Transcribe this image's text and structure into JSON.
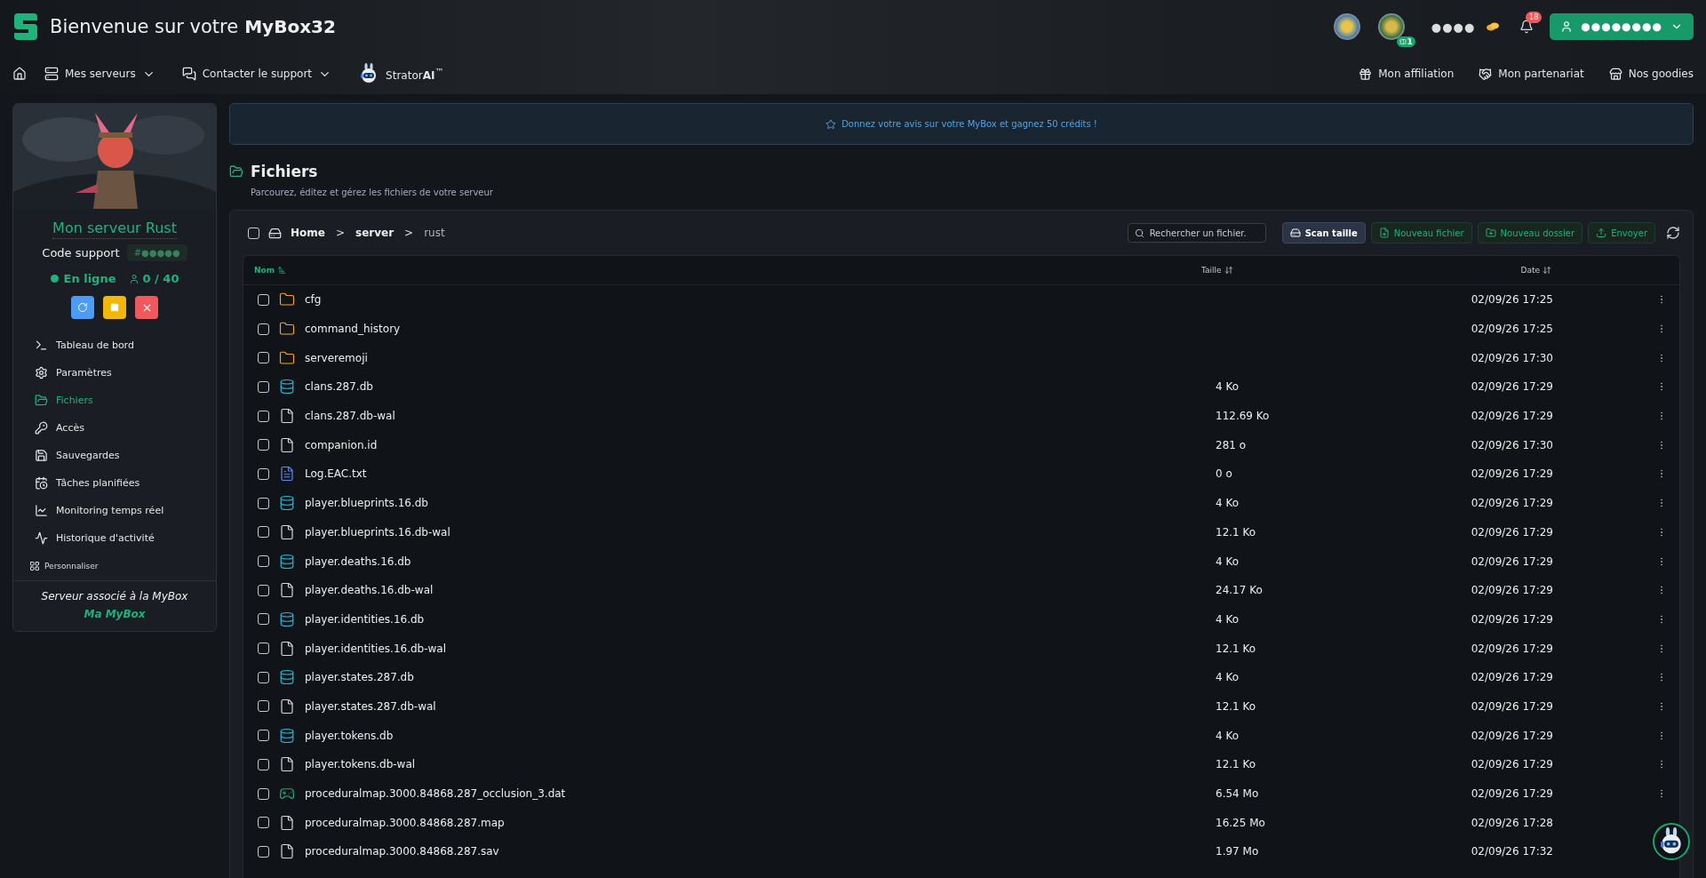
{
  "header": {
    "greeting": "Bienvenue sur votre",
    "box_name": "MyBox32",
    "coins": "●●●●",
    "ticket_badge": "1",
    "notifications": "18",
    "user": "●●●●●●●●"
  },
  "nav": {
    "left": [
      {
        "label": "Mes serveurs",
        "kind": "dropdown"
      },
      {
        "label": "Contacter le support",
        "kind": "dropdown"
      },
      {
        "label": "Strator**AI**$^{™}$",
        "kind": "brand"
      }
    ],
    "right": [
      {
        "label": "Mon affiliation",
        "kind": "gift"
      },
      {
        "label": "Mon partenariat",
        "kind": "handshake"
      },
      {
        "label": "Nos goodies",
        "kind": "store"
      }
    ]
  },
  "sidebar": {
    "server_name": "Mon serveur Rust",
    "code_label": "Code support",
    "code": "#●●●●●",
    "status": "En ligne",
    "online": true,
    "players": "0 / 40",
    "menu": [
      {
        "label": "Tableau de bord",
        "kind": "terminal",
        "selected": false
      },
      {
        "label": "Paramètres",
        "kind": "settings",
        "selected": false
      },
      {
        "label": "Fichiers",
        "kind": "folder",
        "selected": true
      },
      {
        "label": "Accès",
        "kind": "key",
        "selected": false
      },
      {
        "label": "Sauvegardes",
        "kind": "save",
        "selected": false
      },
      {
        "label": "Tâches planifiées",
        "kind": "calendar",
        "selected": false
      },
      {
        "label": "Monitoring temps réel",
        "kind": "chart",
        "selected": false
      },
      {
        "label": "Historique d'activité",
        "kind": "activity",
        "selected": false
      }
    ],
    "customize": "Personnaliser",
    "footer": "Serveur associé à la MyBox",
    "footer_link": "Ma MyBox"
  },
  "banner": "Donnez votre avis sur votre MyBox et gagnez 50 crédits !",
  "page": {
    "title": "Fichiers",
    "subtitle": "Parcourez, éditez et gérez les fichiers de votre serveur"
  },
  "toolbar": {
    "select_all": false,
    "breadcrumb": [
      "Home",
      "server",
      "rust"
    ],
    "separator": ">",
    "search_placeholder": "Rechercher un fichier.",
    "buttons": [
      {
        "label": "Scan taille",
        "kind": "neutral"
      },
      {
        "label": "Nouveau fichier",
        "kind": "file"
      },
      {
        "label": "Nouveau dossier",
        "kind": "folder"
      },
      {
        "label": "Envoyer",
        "kind": "upload"
      }
    ]
  },
  "table": {
    "columns": [
      {
        "label": "Nom",
        "sorted": true
      },
      {
        "label": "Taille",
        "sorted": false
      },
      {
        "label": "Date",
        "sorted": false
      }
    ],
    "rows": [
      {
        "name": "cfg",
        "kind": "folder",
        "size": "",
        "date": "02/09/26 17:25",
        "checked": false
      },
      {
        "name": "command_history",
        "kind": "folder",
        "size": "",
        "date": "02/09/26 17:25",
        "checked": false
      },
      {
        "name": "serveremoji",
        "kind": "folder",
        "size": "",
        "date": "02/09/26 17:30",
        "checked": false
      },
      {
        "name": "clans.287.db",
        "kind": "db",
        "size": "4 Ko",
        "date": "02/09/26 17:29",
        "checked": false
      },
      {
        "name": "clans.287.db-wal",
        "kind": "file",
        "size": "112.69 Ko",
        "date": "02/09/26 17:29",
        "checked": false
      },
      {
        "name": "companion.id",
        "kind": "file",
        "size": "281 o",
        "date": "02/09/26 17:30",
        "checked": false
      },
      {
        "name": "Log.EAC.txt",
        "kind": "text",
        "size": "0 o",
        "date": "02/09/26 17:29",
        "checked": false
      },
      {
        "name": "player.blueprints.16.db",
        "kind": "db",
        "size": "4 Ko",
        "date": "02/09/26 17:29",
        "checked": false
      },
      {
        "name": "player.blueprints.16.db-wal",
        "kind": "file",
        "size": "12.1 Ko",
        "date": "02/09/26 17:29",
        "checked": false
      },
      {
        "name": "player.deaths.16.db",
        "kind": "db",
        "size": "4 Ko",
        "date": "02/09/26 17:29",
        "checked": false
      },
      {
        "name": "player.deaths.16.db-wal",
        "kind": "file",
        "size": "24.17 Ko",
        "date": "02/09/26 17:29",
        "checked": false
      },
      {
        "name": "player.identities.16.db",
        "kind": "db",
        "size": "4 Ko",
        "date": "02/09/26 17:29",
        "checked": false
      },
      {
        "name": "player.identities.16.db-wal",
        "kind": "file",
        "size": "12.1 Ko",
        "date": "02/09/26 17:29",
        "checked": false
      },
      {
        "name": "player.states.287.db",
        "kind": "db",
        "size": "4 Ko",
        "date": "02/09/26 17:29",
        "checked": false
      },
      {
        "name": "player.states.287.db-wal",
        "kind": "file",
        "size": "12.1 Ko",
        "date": "02/09/26 17:29",
        "checked": false
      },
      {
        "name": "player.tokens.db",
        "kind": "db",
        "size": "4 Ko",
        "date": "02/09/26 17:29",
        "checked": false
      },
      {
        "name": "player.tokens.db-wal",
        "kind": "file",
        "size": "12.1 Ko",
        "date": "02/09/26 17:29",
        "checked": false
      },
      {
        "name": "proceduralmap.3000.84868.287_occlusion_3.dat",
        "kind": "game",
        "size": "6.54 Mo",
        "date": "02/09/26 17:29",
        "checked": false
      },
      {
        "name": "proceduralmap.3000.84868.287.map",
        "kind": "file",
        "size": "16.25 Mo",
        "date": "02/09/26 17:28",
        "checked": false
      },
      {
        "name": "proceduralmap.3000.84868.287.sav",
        "kind": "file",
        "size": "1.97 Mo",
        "date": "02/09/26 17:32",
        "checked": false
      }
    ]
  }
}
